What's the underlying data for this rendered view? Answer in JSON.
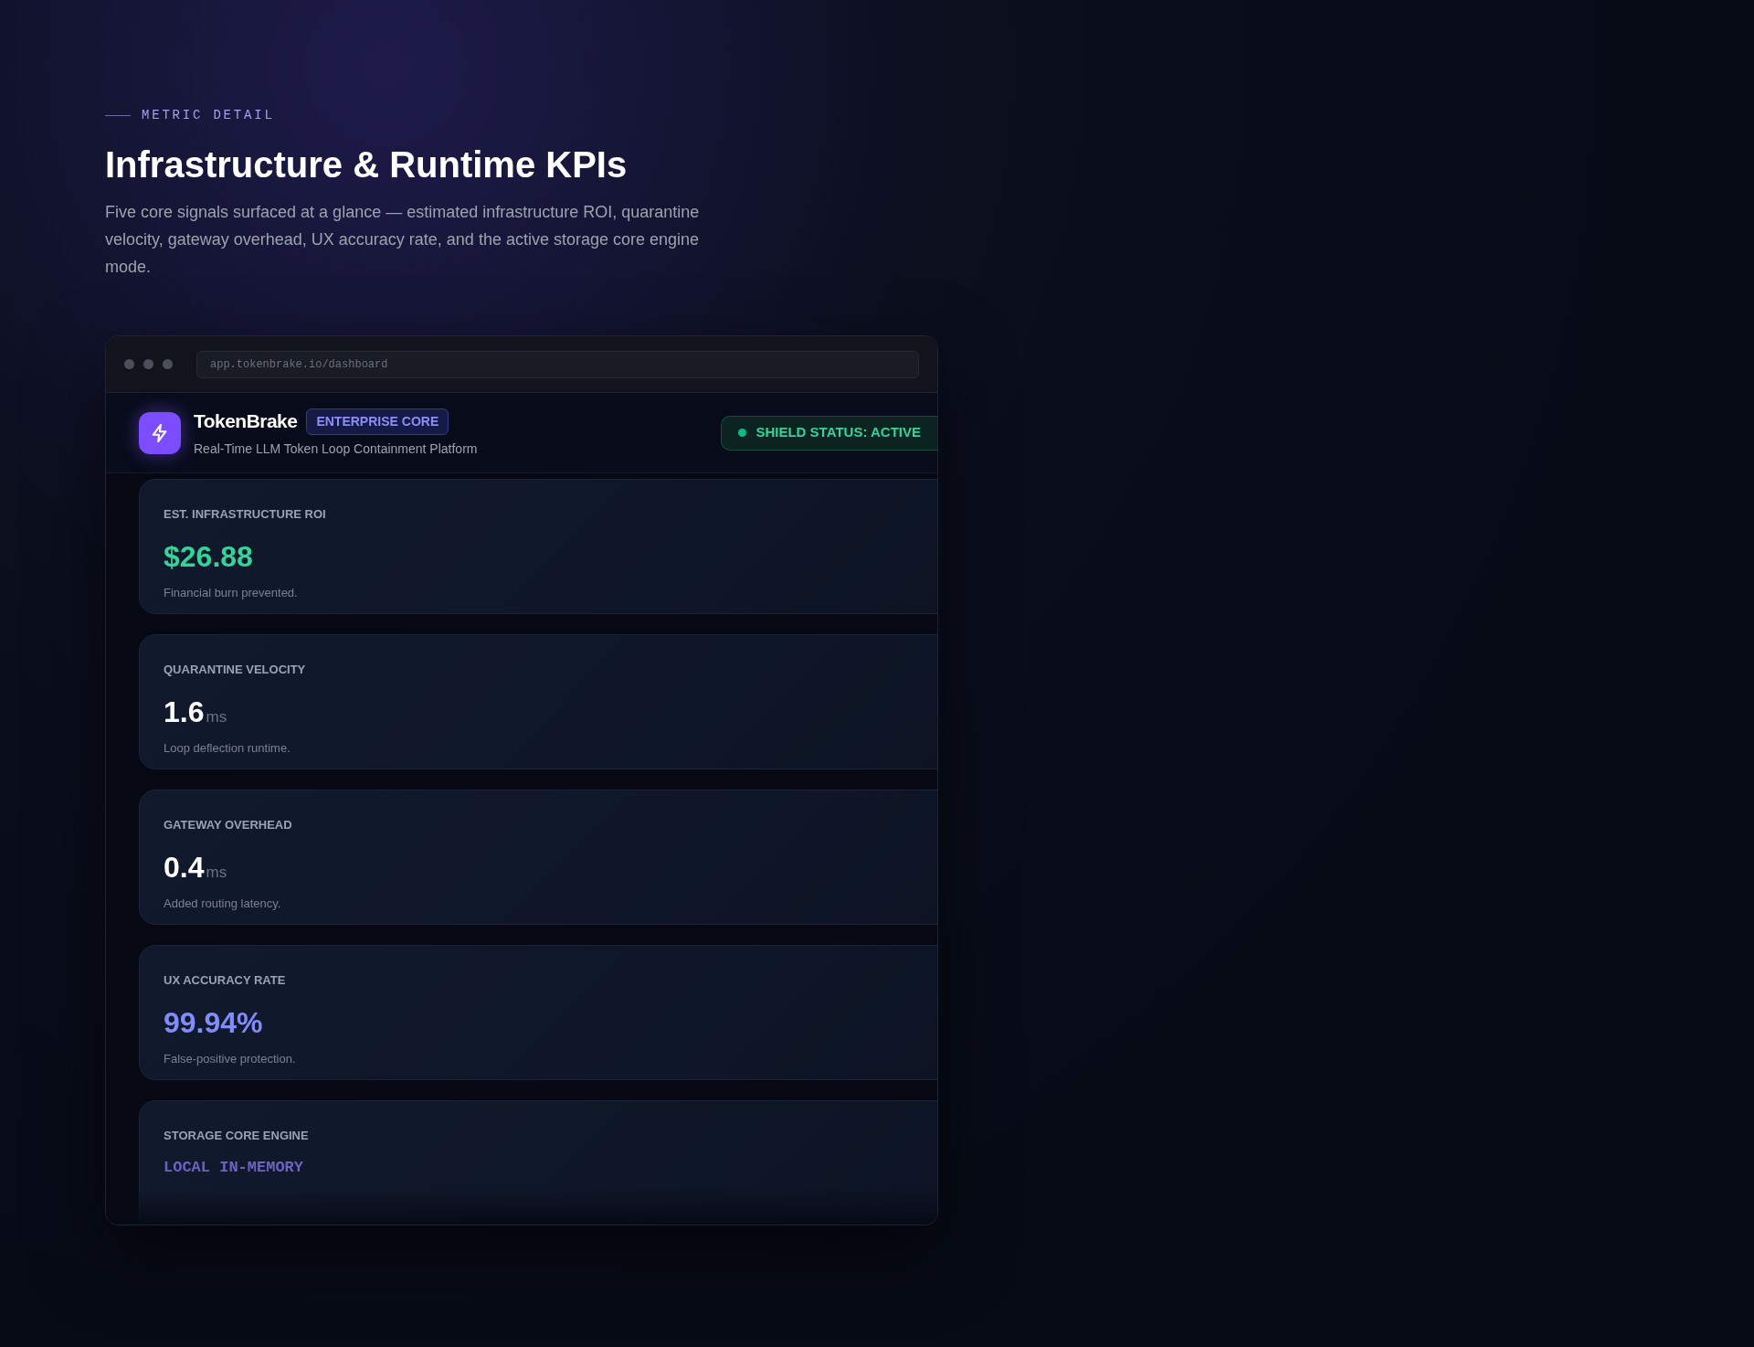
{
  "eyebrow": "METRIC DETAIL",
  "title": "Infrastructure & Runtime KPIs",
  "description": "Five core signals surfaced at a glance — estimated infrastructure ROI, quarantine velocity, gateway overhead, UX accuracy rate, and the active storage core engine mode.",
  "browser": {
    "url": "app.tokenbrake.io/dashboard"
  },
  "app_header": {
    "name": "TokenBrake",
    "badge": "ENTERPRISE CORE",
    "subtitle": "Real-Time LLM Token Loop Containment Platform",
    "status": "SHIELD STATUS: ACTIVE"
  },
  "metrics": [
    {
      "label": "EST. INFRASTRUCTURE ROI",
      "value": "$26.88",
      "kind": "green",
      "caption": "Financial burn prevented."
    },
    {
      "label": "QUARANTINE VELOCITY",
      "value": "1.6",
      "unit": "ms",
      "kind": "white",
      "caption": "Loop deflection runtime."
    },
    {
      "label": "GATEWAY OVERHEAD",
      "value": "0.4",
      "unit": "ms",
      "kind": "white",
      "caption": "Added routing latency."
    },
    {
      "label": "UX ACCURACY RATE",
      "value": "99.94%",
      "kind": "indigo",
      "caption": "False-positive protection."
    },
    {
      "label": "STORAGE CORE ENGINE",
      "value": "LOCAL IN-MEMORY",
      "kind": "mono"
    }
  ]
}
